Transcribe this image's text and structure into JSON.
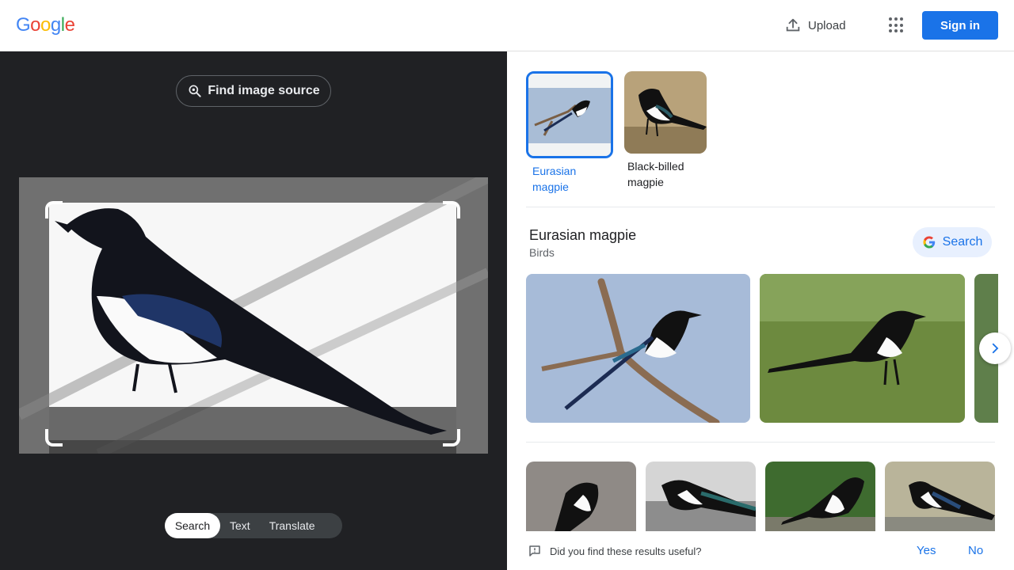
{
  "header": {
    "logo": [
      "G",
      "o",
      "o",
      "g",
      "l",
      "e"
    ],
    "upload_label": "Upload",
    "signin_label": "Sign in"
  },
  "left": {
    "find_source_label": "Find image source",
    "modes": [
      {
        "label": "Search",
        "active": true
      },
      {
        "label": "Text",
        "active": false
      },
      {
        "label": "Translate",
        "active": false
      }
    ]
  },
  "right": {
    "chips": [
      {
        "label": "Eurasian magpie",
        "selected": true
      },
      {
        "label": "Black-billed magpie",
        "selected": false
      }
    ],
    "entity": {
      "title": "Eurasian magpie",
      "subtitle": "Birds",
      "search_label": "Search"
    },
    "feedback": {
      "question": "Did you find these results useful?",
      "yes": "Yes",
      "no": "No"
    }
  },
  "colors": {
    "accent": "#1a73e8",
    "dark_panel": "#202124"
  }
}
